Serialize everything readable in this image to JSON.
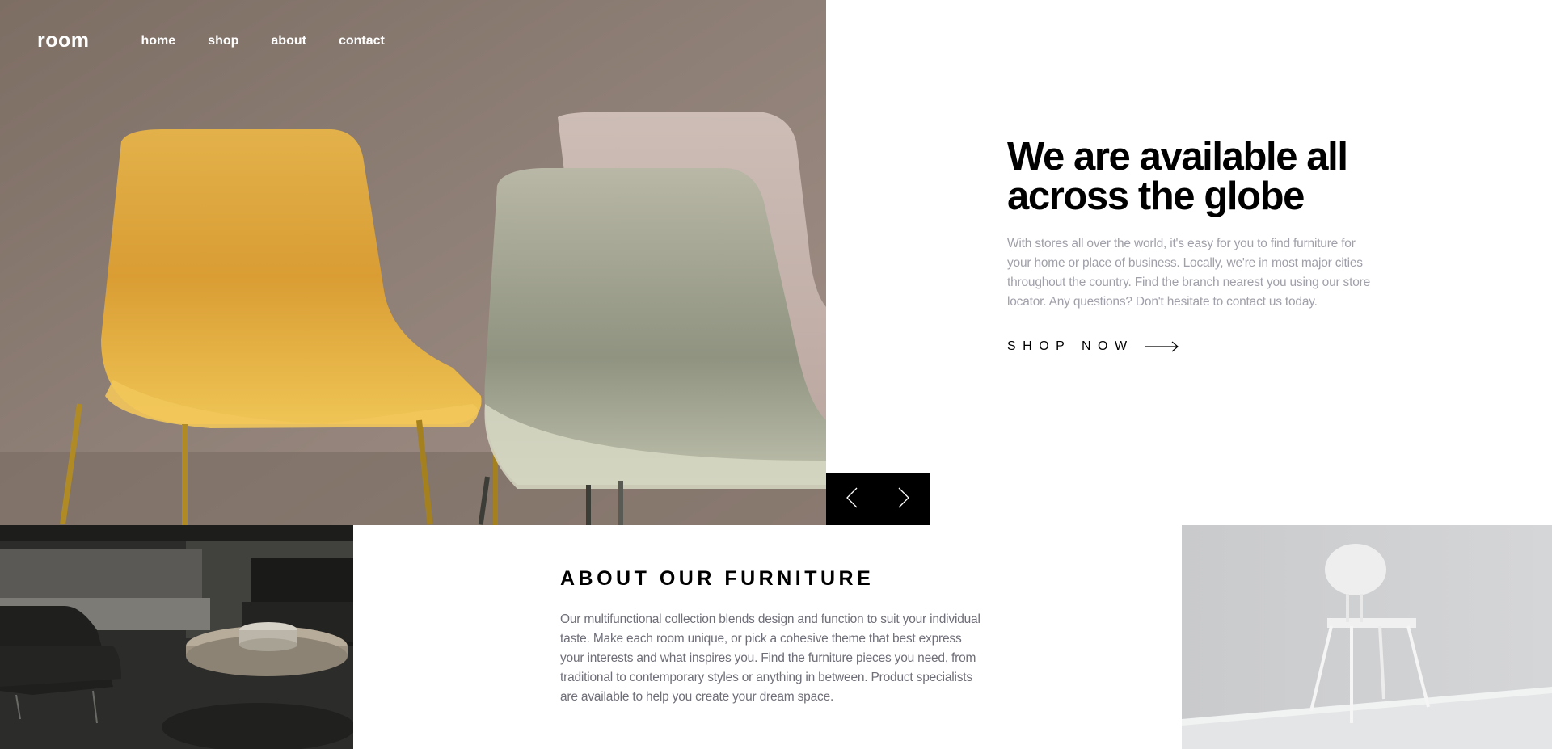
{
  "header": {
    "logo": "room",
    "nav": [
      {
        "label": "home"
      },
      {
        "label": "shop"
      },
      {
        "label": "about"
      },
      {
        "label": "contact"
      }
    ]
  },
  "hero": {
    "title_line1": "We are available all",
    "title_line2": "across the globe",
    "description": "With stores all over the world, it's easy for you to find furniture for your home or place of business. Locally, we're in most major cities throughout the country. Find the branch nearest you using our store locator. Any questions? Don't hesitate to contact us today.",
    "cta_label": "SHOP NOW",
    "cta_icon": "arrow-right-icon",
    "image": "yellow-and-gray-chairs-photo"
  },
  "slider": {
    "prev_icon": "chevron-left-icon",
    "next_icon": "chevron-right-icon"
  },
  "about": {
    "title": "ABOUT OUR FURNITURE",
    "description": "Our multifunctional collection blends design and function to suit your individual taste. Make each room unique, or pick a cohesive theme that best express your interests and what inspires you. Find the furniture pieces you need, from traditional to contemporary styles or anything in between. Product specialists are available to help you create your dream space.",
    "image_left": "dark-living-room-photo",
    "image_right": "white-chair-photo"
  },
  "colors": {
    "text_dark": "#000000",
    "text_muted": "#a0a0aa",
    "text_body": "#6e6e78",
    "controls_bg": "#000000"
  }
}
